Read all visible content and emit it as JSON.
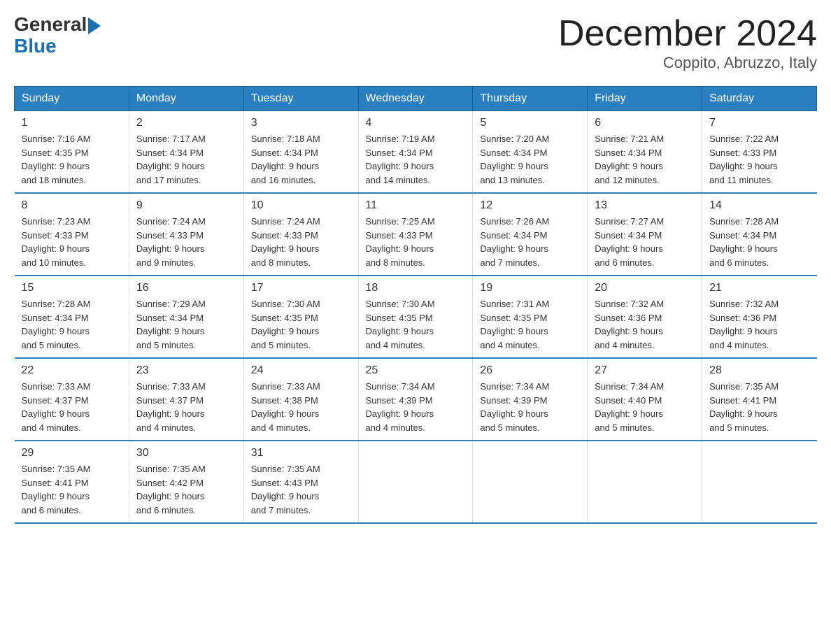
{
  "logo": {
    "general": "General",
    "blue": "Blue"
  },
  "title": {
    "month_year": "December 2024",
    "location": "Coppito, Abruzzo, Italy"
  },
  "weekdays": [
    "Sunday",
    "Monday",
    "Tuesday",
    "Wednesday",
    "Thursday",
    "Friday",
    "Saturday"
  ],
  "weeks": [
    [
      {
        "day": "1",
        "sunrise": "7:16 AM",
        "sunset": "4:35 PM",
        "daylight": "9 hours and 18 minutes."
      },
      {
        "day": "2",
        "sunrise": "7:17 AM",
        "sunset": "4:34 PM",
        "daylight": "9 hours and 17 minutes."
      },
      {
        "day": "3",
        "sunrise": "7:18 AM",
        "sunset": "4:34 PM",
        "daylight": "9 hours and 16 minutes."
      },
      {
        "day": "4",
        "sunrise": "7:19 AM",
        "sunset": "4:34 PM",
        "daylight": "9 hours and 14 minutes."
      },
      {
        "day": "5",
        "sunrise": "7:20 AM",
        "sunset": "4:34 PM",
        "daylight": "9 hours and 13 minutes."
      },
      {
        "day": "6",
        "sunrise": "7:21 AM",
        "sunset": "4:34 PM",
        "daylight": "9 hours and 12 minutes."
      },
      {
        "day": "7",
        "sunrise": "7:22 AM",
        "sunset": "4:33 PM",
        "daylight": "9 hours and 11 minutes."
      }
    ],
    [
      {
        "day": "8",
        "sunrise": "7:23 AM",
        "sunset": "4:33 PM",
        "daylight": "9 hours and 10 minutes."
      },
      {
        "day": "9",
        "sunrise": "7:24 AM",
        "sunset": "4:33 PM",
        "daylight": "9 hours and 9 minutes."
      },
      {
        "day": "10",
        "sunrise": "7:24 AM",
        "sunset": "4:33 PM",
        "daylight": "9 hours and 8 minutes."
      },
      {
        "day": "11",
        "sunrise": "7:25 AM",
        "sunset": "4:33 PM",
        "daylight": "9 hours and 8 minutes."
      },
      {
        "day": "12",
        "sunrise": "7:26 AM",
        "sunset": "4:34 PM",
        "daylight": "9 hours and 7 minutes."
      },
      {
        "day": "13",
        "sunrise": "7:27 AM",
        "sunset": "4:34 PM",
        "daylight": "9 hours and 6 minutes."
      },
      {
        "day": "14",
        "sunrise": "7:28 AM",
        "sunset": "4:34 PM",
        "daylight": "9 hours and 6 minutes."
      }
    ],
    [
      {
        "day": "15",
        "sunrise": "7:28 AM",
        "sunset": "4:34 PM",
        "daylight": "9 hours and 5 minutes."
      },
      {
        "day": "16",
        "sunrise": "7:29 AM",
        "sunset": "4:34 PM",
        "daylight": "9 hours and 5 minutes."
      },
      {
        "day": "17",
        "sunrise": "7:30 AM",
        "sunset": "4:35 PM",
        "daylight": "9 hours and 5 minutes."
      },
      {
        "day": "18",
        "sunrise": "7:30 AM",
        "sunset": "4:35 PM",
        "daylight": "9 hours and 4 minutes."
      },
      {
        "day": "19",
        "sunrise": "7:31 AM",
        "sunset": "4:35 PM",
        "daylight": "9 hours and 4 minutes."
      },
      {
        "day": "20",
        "sunrise": "7:32 AM",
        "sunset": "4:36 PM",
        "daylight": "9 hours and 4 minutes."
      },
      {
        "day": "21",
        "sunrise": "7:32 AM",
        "sunset": "4:36 PM",
        "daylight": "9 hours and 4 minutes."
      }
    ],
    [
      {
        "day": "22",
        "sunrise": "7:33 AM",
        "sunset": "4:37 PM",
        "daylight": "9 hours and 4 minutes."
      },
      {
        "day": "23",
        "sunrise": "7:33 AM",
        "sunset": "4:37 PM",
        "daylight": "9 hours and 4 minutes."
      },
      {
        "day": "24",
        "sunrise": "7:33 AM",
        "sunset": "4:38 PM",
        "daylight": "9 hours and 4 minutes."
      },
      {
        "day": "25",
        "sunrise": "7:34 AM",
        "sunset": "4:39 PM",
        "daylight": "9 hours and 4 minutes."
      },
      {
        "day": "26",
        "sunrise": "7:34 AM",
        "sunset": "4:39 PM",
        "daylight": "9 hours and 5 minutes."
      },
      {
        "day": "27",
        "sunrise": "7:34 AM",
        "sunset": "4:40 PM",
        "daylight": "9 hours and 5 minutes."
      },
      {
        "day": "28",
        "sunrise": "7:35 AM",
        "sunset": "4:41 PM",
        "daylight": "9 hours and 5 minutes."
      }
    ],
    [
      {
        "day": "29",
        "sunrise": "7:35 AM",
        "sunset": "4:41 PM",
        "daylight": "9 hours and 6 minutes."
      },
      {
        "day": "30",
        "sunrise": "7:35 AM",
        "sunset": "4:42 PM",
        "daylight": "9 hours and 6 minutes."
      },
      {
        "day": "31",
        "sunrise": "7:35 AM",
        "sunset": "4:43 PM",
        "daylight": "9 hours and 7 minutes."
      },
      null,
      null,
      null,
      null
    ]
  ],
  "labels": {
    "sunrise": "Sunrise:",
    "sunset": "Sunset:",
    "daylight": "Daylight:"
  }
}
